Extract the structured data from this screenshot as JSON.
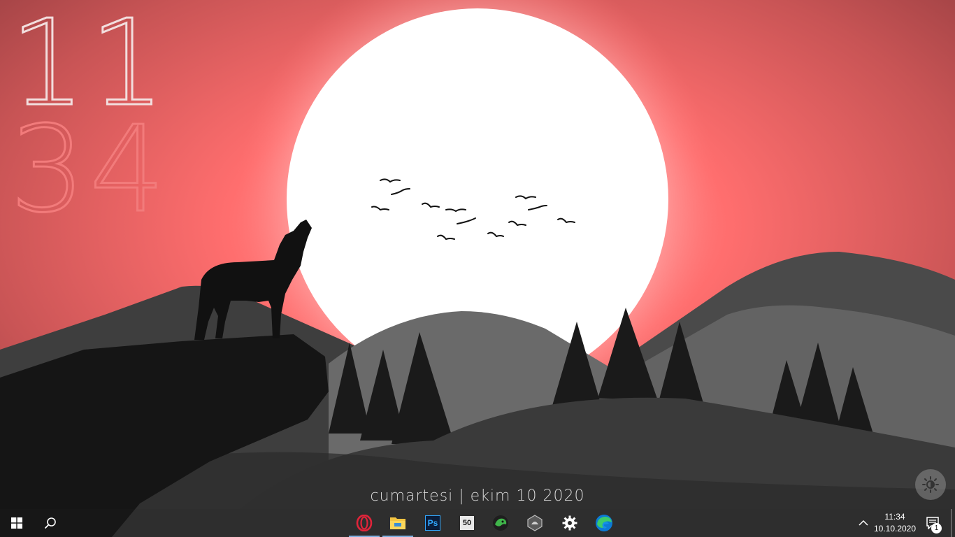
{
  "desktop": {
    "clock": {
      "hour": "11",
      "minute": "34"
    },
    "date_line": "cumartesi  |  ekim 10 2020"
  },
  "taskbar": {
    "start_icon": "windows-start-icon",
    "search_icon": "search-icon",
    "apps": [
      {
        "name": "opera-icon",
        "active": true
      },
      {
        "name": "file-explorer-icon",
        "active": true
      },
      {
        "name": "photoshop-icon",
        "label": "Ps",
        "active": false
      },
      {
        "name": "fifty-app-icon",
        "label": "50",
        "active": false
      },
      {
        "name": "green-monster-icon",
        "active": false
      },
      {
        "name": "hexagon-app-icon",
        "active": false
      },
      {
        "name": "settings-gear-icon",
        "active": false
      },
      {
        "name": "edge-icon",
        "active": false
      }
    ],
    "tray": {
      "time": "11:34",
      "date": "10.10.2020",
      "notification_count": "1"
    }
  },
  "colors": {
    "sky_top": "#d9605f",
    "sky_glow": "#ff7777",
    "moon": "#ffffff",
    "hour_digits": "#f2dede",
    "minute_digits": "#f27b7b"
  }
}
